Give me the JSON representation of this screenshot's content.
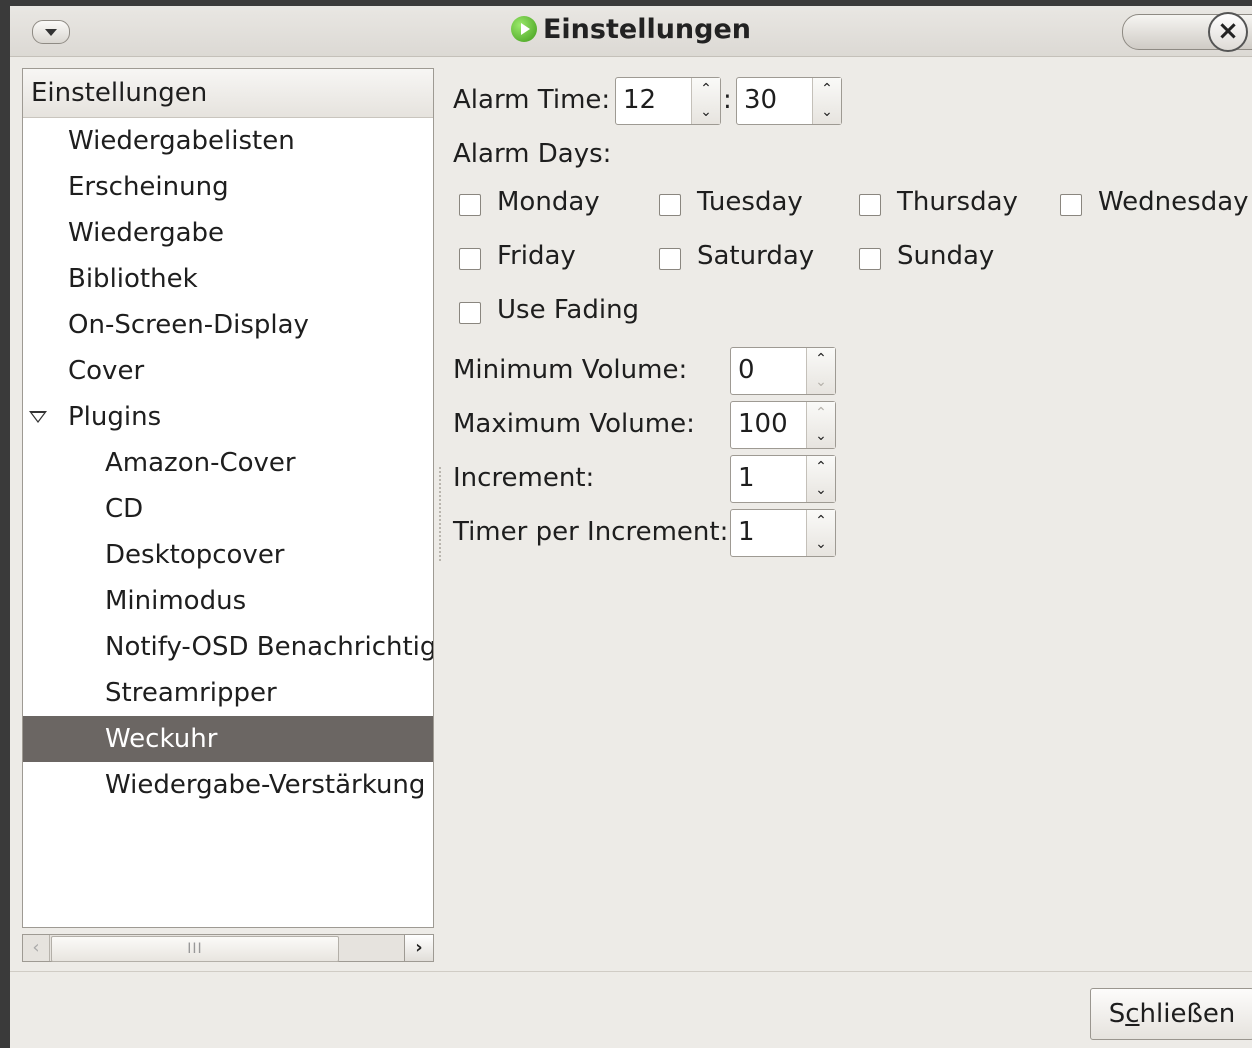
{
  "window": {
    "title": "Einstellungen",
    "menu_icon": "chevron-down-icon",
    "app_icon": "play-circle-icon",
    "close_icon": "close-icon"
  },
  "tree": {
    "header": "Einstellungen",
    "items": [
      {
        "label": "Wiedergabelisten",
        "level": 1
      },
      {
        "label": "Erscheinung",
        "level": 1
      },
      {
        "label": "Wiedergabe",
        "level": 1
      },
      {
        "label": "Bibliothek",
        "level": 1
      },
      {
        "label": "On-Screen-Display",
        "level": 1
      },
      {
        "label": "Cover",
        "level": 1
      },
      {
        "label": "Plugins",
        "level": 1,
        "expanded": true
      },
      {
        "label": "Amazon-Cover",
        "level": 2
      },
      {
        "label": "CD",
        "level": 2
      },
      {
        "label": "Desktopcover",
        "level": 2
      },
      {
        "label": "Minimodus",
        "level": 2
      },
      {
        "label": "Notify-OSD Benachrichtigungen",
        "level": 2
      },
      {
        "label": "Streamripper",
        "level": 2
      },
      {
        "label": "Weckuhr",
        "level": 2,
        "selected": true
      },
      {
        "label": "Wiedergabe-Verstärkung",
        "level": 2
      }
    ],
    "scrollbar_grip": "III"
  },
  "settings": {
    "alarm_time_label": "Alarm Time:",
    "alarm_hour": "12",
    "time_separator": ":",
    "alarm_minute": "30",
    "alarm_days_label": "Alarm Days:",
    "days": {
      "monday": "Monday",
      "tuesday": "Tuesday",
      "thursday": "Thursday",
      "wednesday": "Wednesday",
      "friday": "Friday",
      "saturday": "Saturday",
      "sunday": "Sunday"
    },
    "use_fading_label": "Use Fading",
    "min_volume_label": "Minimum Volume:",
    "min_volume": "0",
    "max_volume_label": "Maximum Volume:",
    "max_volume": "100",
    "increment_label": "Increment:",
    "increment": "1",
    "timer_label": "Timer per Increment:",
    "timer": "1"
  },
  "footer": {
    "close_label_pre": "S",
    "close_label_mnemonic": "c",
    "close_label_post": "hließen"
  },
  "colors": {
    "selection": "#6b6663",
    "window_bg": "#edebe7"
  }
}
